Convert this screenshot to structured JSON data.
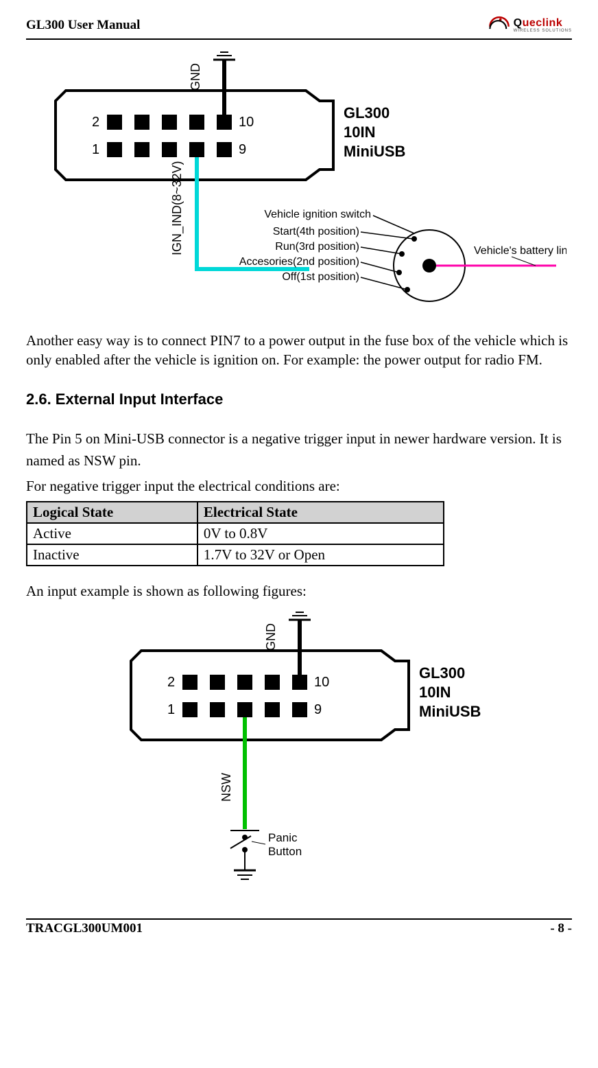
{
  "header": {
    "title": "GL300 User Manual",
    "brand_q": "Q",
    "brand_rest": "ueclink",
    "brand_tag": "WIRELESS SOLUTIONS"
  },
  "fig1": {
    "pin2": "2",
    "pin1": "1",
    "pin10": "10",
    "pin9": "9",
    "gnd": "GND",
    "ign": "IGN_IND(8~32V)",
    "device_l1": "GL300",
    "device_l2": "10IN",
    "device_l3": "MiniUSB",
    "switch_title": "Vehicle ignition switch",
    "pos4": "Start(4th position)",
    "pos3": "Run(3rd position)",
    "pos2": "Accesories(2nd position)",
    "pos1": "Off(1st position)",
    "battery": "Vehicle's battery line"
  },
  "para1": "Another easy way is to connect PIN7 to a power output in the fuse box of the vehicle which is only enabled after the vehicle is ignition on. For example: the power output for radio FM.",
  "section_title": "2.6. External Input Interface",
  "body1": "The Pin 5 on Mini-USB connector is a negative trigger input in newer hardware version. It is named as NSW pin.",
  "body2": "For negative trigger input the electrical conditions are:",
  "table": {
    "h1": "Logical State",
    "h2": "Electrical State",
    "r1c1": "Active",
    "r1c2": "0V to 0.8V",
    "r2c1": "Inactive",
    "r2c2": "1.7V to 32V or Open"
  },
  "body3": "An input example is shown as following figures:",
  "fig2": {
    "pin2": "2",
    "pin1": "1",
    "pin10": "10",
    "pin9": "9",
    "gnd": "GND",
    "nsw": "NSW",
    "device_l1": "GL300",
    "device_l2": "10IN",
    "device_l3": "MiniUSB",
    "panic_l1": "Panic",
    "panic_l2": "Button"
  },
  "footer": {
    "doc_id": "TRACGL300UM001",
    "page_num": "- 8 -"
  }
}
